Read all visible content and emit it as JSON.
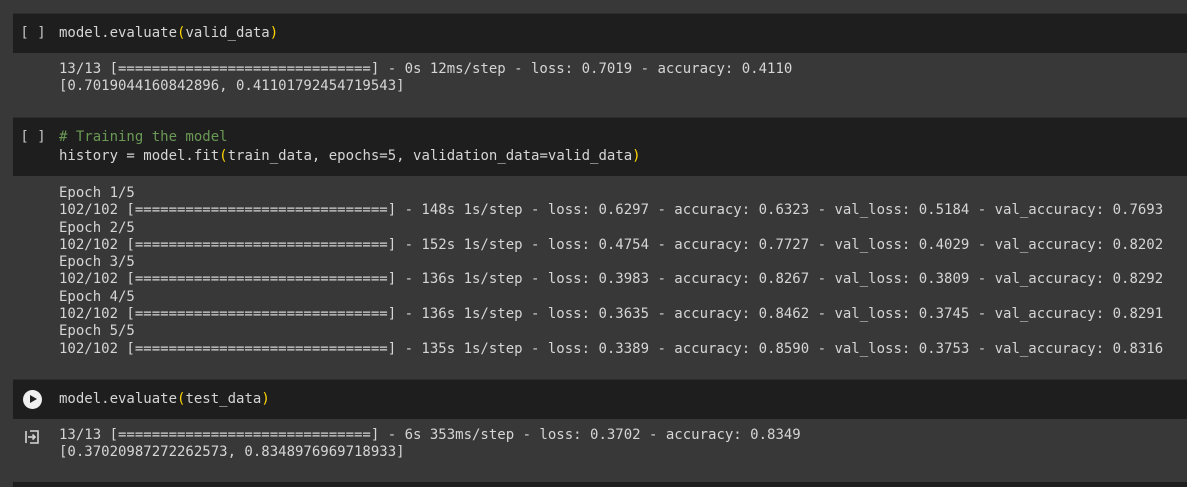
{
  "cells": [
    {
      "gutter": "[ ]",
      "code": {
        "prefix": "model.evaluate",
        "open": "(",
        "arg": "valid_data",
        "close": ")"
      },
      "output": [
        "13/13 [==============================] - 0s 12ms/step - loss: 0.7019 - accuracy: 0.4110",
        "[0.7019044160842896, 0.41101792454719543]"
      ]
    },
    {
      "gutter": "[ ]",
      "comment": "# Training the model",
      "code": {
        "prefix": "history = model.fit",
        "open": "(",
        "arg": "train_data, epochs=5, validation_data=valid_data",
        "close": ")"
      },
      "output": [
        "Epoch 1/5",
        "102/102 [==============================] - 148s 1s/step - loss: 0.6297 - accuracy: 0.6323 - val_loss: 0.5184 - val_accuracy: 0.7693",
        "Epoch 2/5",
        "102/102 [==============================] - 152s 1s/step - loss: 0.4754 - accuracy: 0.7727 - val_loss: 0.4029 - val_accuracy: 0.8202",
        "Epoch 3/5",
        "102/102 [==============================] - 136s 1s/step - loss: 0.3983 - accuracy: 0.8267 - val_loss: 0.3809 - val_accuracy: 0.8292",
        "Epoch 4/5",
        "102/102 [==============================] - 136s 1s/step - loss: 0.3635 - accuracy: 0.8462 - val_loss: 0.3745 - val_accuracy: 0.8291",
        "Epoch 5/5",
        "102/102 [==============================] - 135s 1s/step - loss: 0.3389 - accuracy: 0.8590 - val_loss: 0.3753 - val_accuracy: 0.8316"
      ]
    },
    {
      "run_icon": "play-icon",
      "output_icon": "output-redirect-icon",
      "code": {
        "prefix": "model.evaluate",
        "open": "(",
        "arg": "test_data",
        "close": ")"
      },
      "output": [
        "13/13 [==============================] - 6s 353ms/step - loss: 0.3702 - accuracy: 0.8349",
        "[0.37020987272262573, 0.8348976969718933]"
      ]
    }
  ],
  "colors": {
    "background": "#383838",
    "code_background": "#1e1e1e",
    "paren": "#ffd700",
    "comment": "#6a9955",
    "text": "#d5d5d5"
  }
}
